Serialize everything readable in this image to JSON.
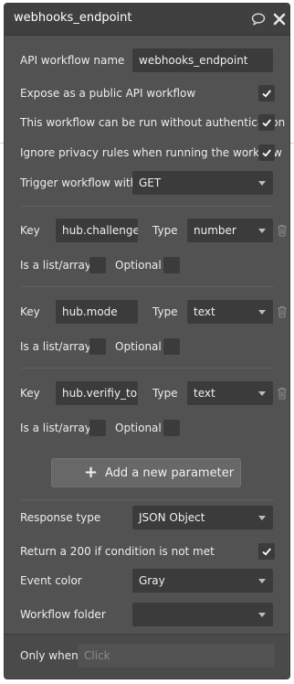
{
  "header": {
    "title": "webhooks_endpoint"
  },
  "settings": {
    "name_label": "API workflow name",
    "name_value": "webhooks_endpoint",
    "expose_label": "Expose as a public API workflow",
    "noauth_label": "This workflow can be run without authentication",
    "privacy_label": "Ignore privacy rules when running the workflow",
    "trigger_label": "Trigger workflow with",
    "trigger_value": "GET"
  },
  "parameters": [
    {
      "key_label": "Key",
      "key": "hub.challenge",
      "type_label": "Type",
      "type": "number",
      "list_label": "Is a list/array",
      "optional_label": "Optional"
    },
    {
      "key_label": "Key",
      "key": "hub.mode",
      "type_label": "Type",
      "type": "text",
      "list_label": "Is a list/array",
      "optional_label": "Optional"
    },
    {
      "key_label": "Key",
      "key": "hub.verifiy_token",
      "type_label": "Type",
      "type": "text",
      "list_label": "Is a list/array",
      "optional_label": "Optional"
    }
  ],
  "add_parameter_label": "Add a new parameter",
  "response": {
    "type_label": "Response type",
    "type_value": "JSON Object",
    "return200_label": "Return a 200 if condition is not met",
    "color_label": "Event color",
    "color_value": "Gray",
    "folder_label": "Workflow folder",
    "folder_value": ""
  },
  "footer": {
    "only_when_label": "Only when",
    "only_when_placeholder": "Click"
  },
  "colors": {
    "panel": "#525252",
    "header": "#404040",
    "field": "#3b3b3b",
    "text": "#f0f0f0"
  },
  "icons": [
    "comment-icon",
    "close-icon",
    "check-icon",
    "trash-icon",
    "plus-icon",
    "chevron-down-icon"
  ]
}
